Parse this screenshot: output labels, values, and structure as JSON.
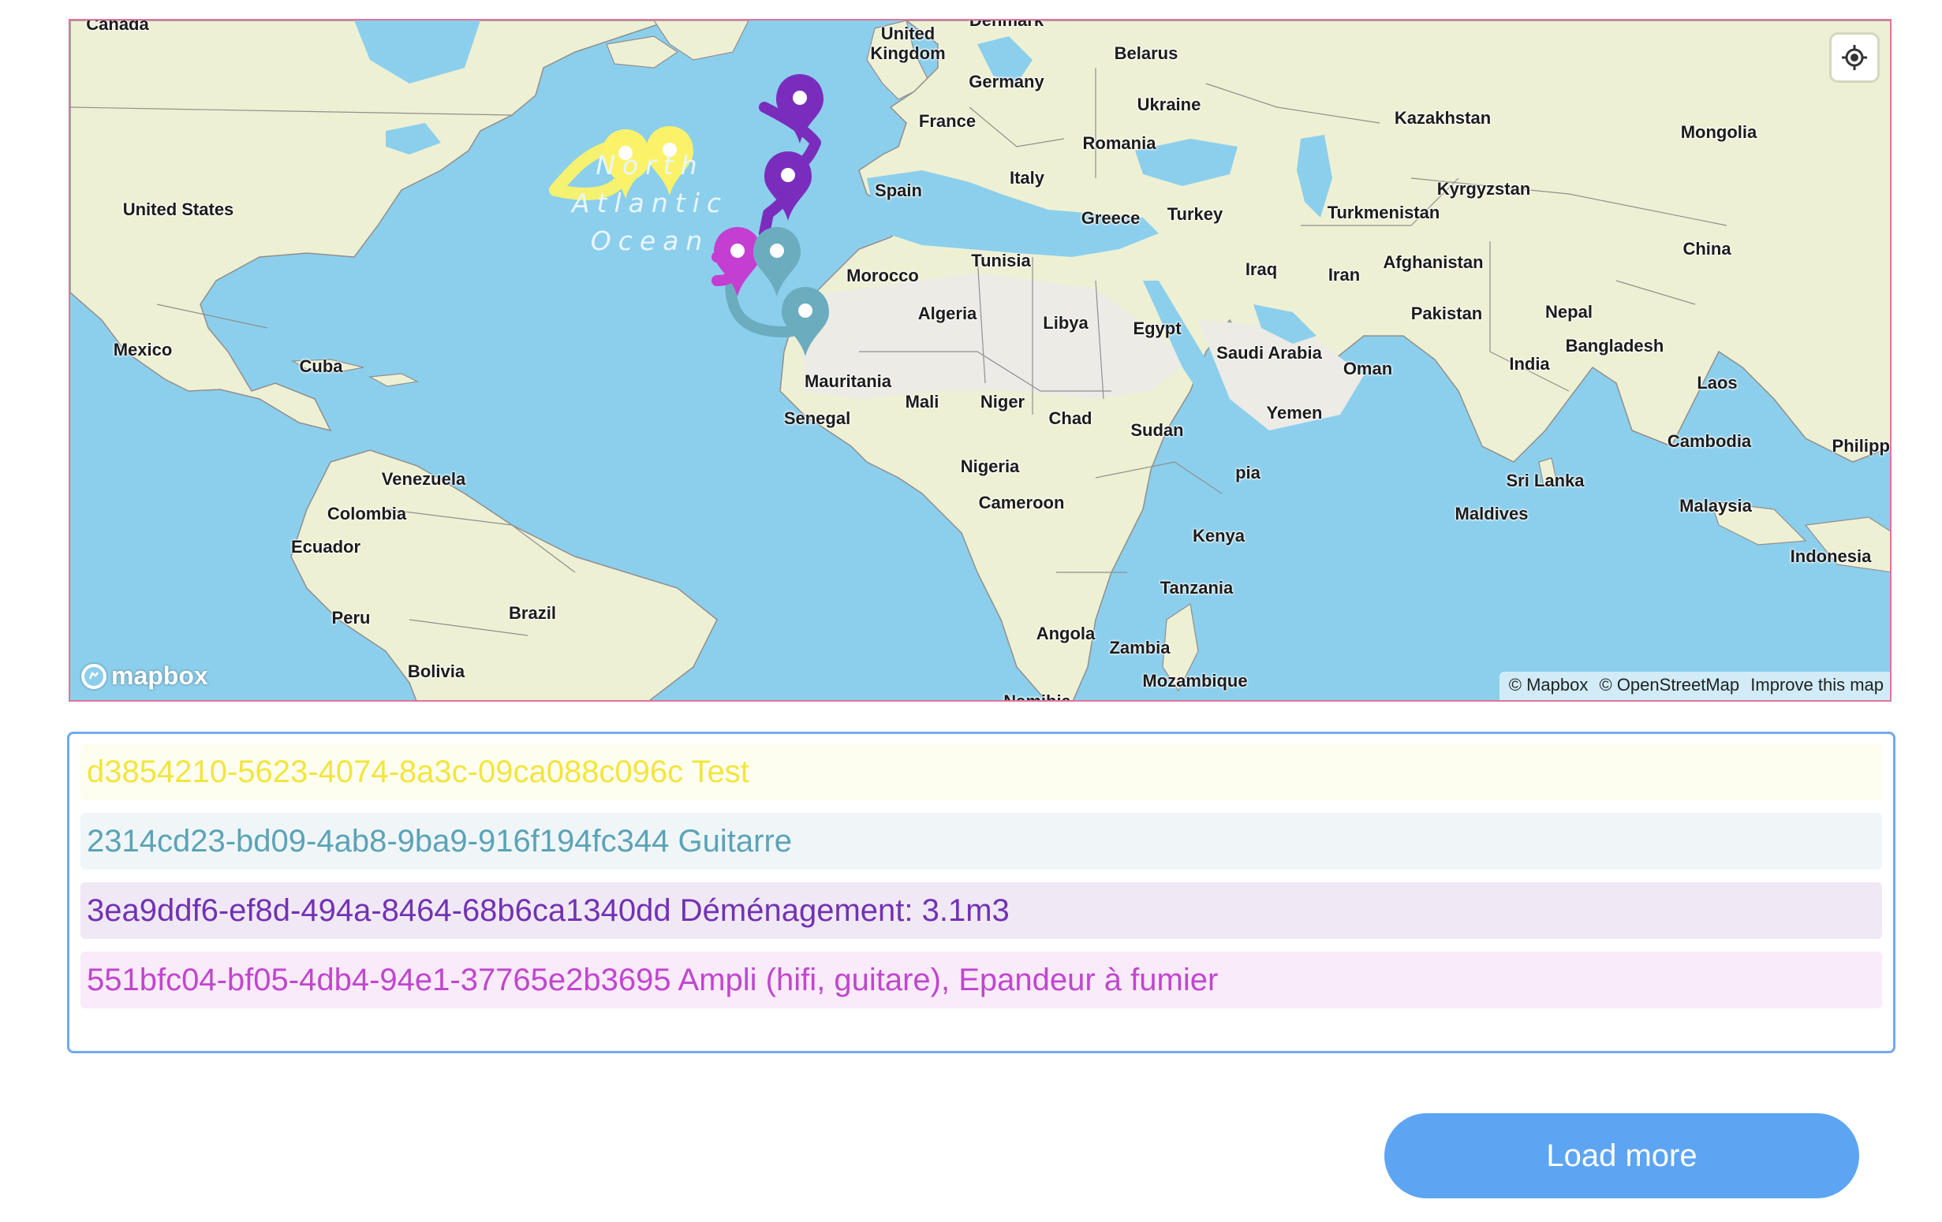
{
  "map": {
    "ocean_label": [
      "North",
      "Atlantic",
      "Ocean"
    ],
    "labels": {
      "canada": "Canada",
      "united_kingdom_1": "United",
      "united_kingdom_2": "Kingdom",
      "denmark": "Denmark",
      "belarus": "Belarus",
      "germany": "Germany",
      "ukraine": "Ukraine",
      "kazakhstan": "Kazakhstan",
      "mongolia": "Mongolia",
      "france": "France",
      "romania": "Romania",
      "italy": "Italy",
      "spain": "Spain",
      "united_states": "United States",
      "kyrgyzstan": "Kyrgyzstan",
      "greece": "Greece",
      "turkey": "Turkey",
      "turkmenistan": "Turkmenistan",
      "china": "China",
      "tunisia": "Tunisia",
      "afghanistan": "Afghanistan",
      "morocco": "Morocco",
      "iraq": "Iraq",
      "iran": "Iran",
      "algeria": "Algeria",
      "libya": "Libya",
      "pakistan": "Pakistan",
      "nepal": "Nepal",
      "egypt": "Egypt",
      "mexico": "Mexico",
      "bangladesh": "Bangladesh",
      "saudi_arabia": "Saudi Arabia",
      "india": "India",
      "cuba": "Cuba",
      "oman": "Oman",
      "mauritania": "Mauritania",
      "laos": "Laos",
      "mali": "Mali",
      "niger": "Niger",
      "senegal": "Senegal",
      "chad": "Chad",
      "yemen": "Yemen",
      "sudan": "Sudan",
      "cambodia": "Cambodia",
      "philippines": "Philippin",
      "venezuela": "Venezuela",
      "nigeria": "Nigeria",
      "ethiopia": "pia",
      "sri_lanka": "Sri Lanka",
      "cameroon": "Cameroon",
      "colombia": "Colombia",
      "maldives": "Maldives",
      "malaysia": "Malaysia",
      "kenya": "Kenya",
      "ecuador": "Ecuador",
      "indonesia": "Indonesia",
      "tanzania": "Tanzania",
      "brazil": "Brazil",
      "peru": "Peru",
      "angola": "Angola",
      "zambia": "Zambia",
      "bolivia": "Bolivia",
      "mozambique": "Mozambique",
      "namibia": "Namibia"
    },
    "logo_text": "mapbox",
    "attribution": [
      "© Mapbox",
      "© OpenStreetMap",
      "Improve this map"
    ],
    "colors": {
      "water": "#8ccfec",
      "land": "#eef0d4",
      "desert": "#ecebe6",
      "border": "#8f8f8f"
    }
  },
  "routes": [
    {
      "id": "d3854210-5623-4074-8a3c-09ca088c096c",
      "name": "Test",
      "color": "#fbf26a",
      "text_color": "#f3e53e",
      "bg": "#fefef0"
    },
    {
      "id": "2314cd23-bd09-4ab8-9ba9-916f194fc344",
      "name": "Guitarre",
      "color": "#6bacbe",
      "text_color": "#5ba3b7",
      "bg": "#f0f6f8"
    },
    {
      "id": "3ea9ddf6-ef8d-494a-8464-68b6ca1340dd",
      "name": "Déménagement: 3.1m3",
      "color": "#7a2dbd",
      "text_color": "#7232b3",
      "bg": "#f1e8f5"
    },
    {
      "id": "551bfc04-bf05-4db4-94e1-37765e2b3695",
      "name": "Ampli (hifi, guitare), Epandeur à fumier",
      "color": "#c33ed1",
      "text_color": "#c146cf",
      "bg": "#f9ebfa"
    }
  ],
  "rows": [
    "d3854210-5623-4074-8a3c-09ca088c096c Test",
    "2314cd23-bd09-4ab8-9ba9-916f194fc344 Guitarre",
    "3ea9ddf6-ef8d-494a-8464-68b6ca1340dd Déménagement: 3.1m3",
    "551bfc04-bf05-4db4-94e1-37765e2b3695 Ampli (hifi, guitare), Epandeur à fumier"
  ],
  "load_more_label": "Load more",
  "icons": {
    "geolocate": "geolocate-icon",
    "logo": "mapbox-logo-icon",
    "marker": "map-pin-icon"
  }
}
